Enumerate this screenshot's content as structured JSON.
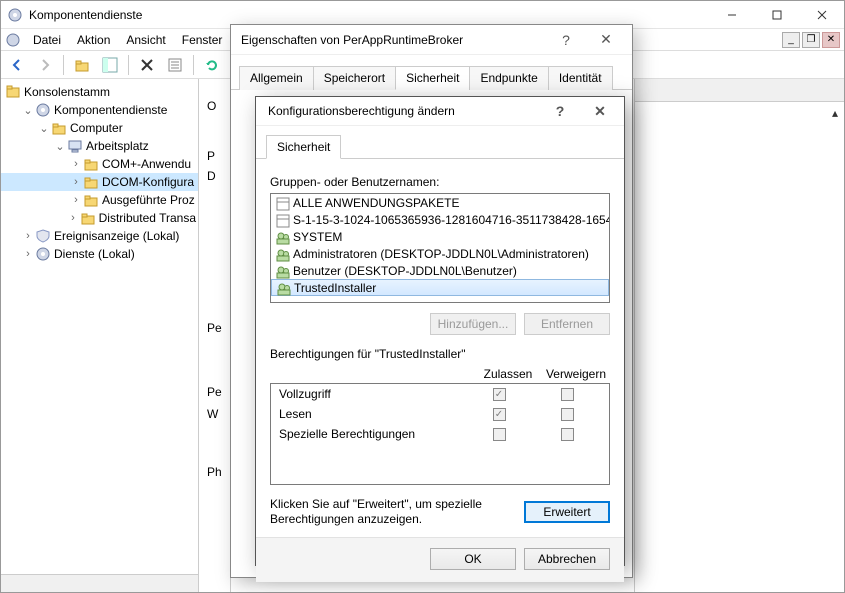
{
  "mmc": {
    "title": "Komponentendienste",
    "menu": [
      "Datei",
      "Aktion",
      "Ansicht",
      "Fenster",
      "?"
    ],
    "tree": {
      "root": "Konsolenstamm",
      "items": [
        {
          "label": "Komponentendienste",
          "depth": 1,
          "icon": "gear",
          "expanded": true
        },
        {
          "label": "Computer",
          "depth": 2,
          "icon": "folder",
          "expanded": true
        },
        {
          "label": "Arbeitsplatz",
          "depth": 3,
          "icon": "pc",
          "expanded": true
        },
        {
          "label": "COM+-Anwendu",
          "depth": 4,
          "icon": "folder",
          "expanded": false,
          "hasChildren": true
        },
        {
          "label": "DCOM-Konfigura",
          "depth": 4,
          "icon": "folder",
          "expanded": false,
          "hasChildren": true,
          "selected": true
        },
        {
          "label": "Ausgeführte Proz",
          "depth": 4,
          "icon": "folder",
          "expanded": false,
          "hasChildren": true
        },
        {
          "label": "Distributed Transa",
          "depth": 4,
          "icon": "folder",
          "expanded": false,
          "hasChildren": true
        },
        {
          "label": "Ereignisanzeige (Lokal)",
          "depth": 1,
          "icon": "shield",
          "expanded": false,
          "hasChildren": true
        },
        {
          "label": "Dienste (Lokal)",
          "depth": 1,
          "icon": "gear",
          "expanded": false,
          "hasChildren": true
        }
      ]
    },
    "main_fragments": [
      "O",
      "P",
      "D",
      "Pe",
      "Pe",
      "W",
      "Ph"
    ]
  },
  "props": {
    "title": "Eigenschaften von PerAppRuntimeBroker",
    "tabs": [
      "Allgemein",
      "Speicherort",
      "Sicherheit",
      "Endpunkte",
      "Identität"
    ],
    "active_tab": 2
  },
  "perm": {
    "title": "Konfigurationsberechtigung ändern",
    "tab": "Sicherheit",
    "group_label": "Gruppen- oder Benutzernamen:",
    "principals": [
      {
        "label": "ALLE ANWENDUNGSPAKETE",
        "icon": "box"
      },
      {
        "label": "S-1-15-3-1024-1065365936-1281604716-3511738428-1654...",
        "icon": "box"
      },
      {
        "label": "SYSTEM",
        "icon": "ppl"
      },
      {
        "label": "Administratoren (DESKTOP-JDDLN0L\\Administratoren)",
        "icon": "ppl"
      },
      {
        "label": "Benutzer (DESKTOP-JDDLN0L\\Benutzer)",
        "icon": "ppl"
      },
      {
        "label": "TrustedInstaller",
        "icon": "ppl",
        "selected": true
      }
    ],
    "add_btn": "Hinzufügen...",
    "remove_btn": "Entfernen",
    "perm_for_label": "Berechtigungen für \"TrustedInstaller\"",
    "col_allow": "Zulassen",
    "col_deny": "Verweigern",
    "rows": [
      {
        "label": "Vollzugriff",
        "allow": true,
        "deny": false
      },
      {
        "label": "Lesen",
        "allow": true,
        "deny": false
      },
      {
        "label": "Spezielle Berechtigungen",
        "allow": false,
        "deny": false
      }
    ],
    "hint": "Klicken Sie auf \"Erweitert\", um spezielle Berechtigungen anzuzeigen.",
    "advanced_btn": "Erweitert",
    "ok_btn": "OK",
    "cancel_btn": "Abbrechen"
  }
}
